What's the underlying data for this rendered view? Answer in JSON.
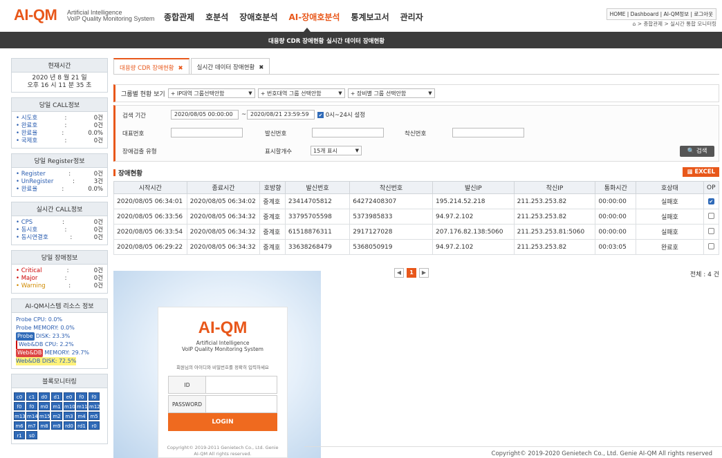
{
  "header": {
    "logo": "AI-QM",
    "logo_sub1": "Artificial Intelligence",
    "logo_sub2": "VoIP Quality Monitoring System",
    "menu": [
      "종합관제",
      "호분석",
      "장애호분석",
      "AI-장애호분석",
      "통계보고서",
      "관리자"
    ],
    "util": "HOME | Dashboard | AI-QM정보 | 로그아웃",
    "breadcrumb": "⌂ > 종합관제 > 실시간 통합 모니터링"
  },
  "subnav": [
    "대용량 CDR 장애현황",
    "실시간 데이터 장애현황"
  ],
  "sidebar": {
    "time_title": "현재시간",
    "time_line1": "2020 년 8 월 21 일",
    "time_line2": "오후 16 시 11 분 35 초",
    "call_title": "당일 CALL정보",
    "call_rows": [
      {
        "k": "• 시도호",
        "s": ":",
        "v": "0건"
      },
      {
        "k": "• 완료호",
        "s": ":",
        "v": "0건"
      },
      {
        "k": "• 완료율",
        "s": ":",
        "v": "0.0%"
      },
      {
        "k": "• 국제호",
        "s": ":",
        "v": "0건"
      }
    ],
    "reg_title": "당일 Register정보",
    "reg_rows": [
      {
        "k": "• Register",
        "s": ":",
        "v": "0건"
      },
      {
        "k": "• UnRegister",
        "s": ":",
        "v": "3건"
      },
      {
        "k": "• 완료율",
        "s": ":",
        "v": "0.0%"
      }
    ],
    "rt_title": "실시간 CALL정보",
    "rt_rows": [
      {
        "k": "• CPS",
        "s": ":",
        "v": "0건"
      },
      {
        "k": "• 동시호",
        "s": ":",
        "v": "0건"
      },
      {
        "k": "• 동시연결호",
        "s": ":",
        "v": "0건"
      }
    ],
    "alarm_title": "당일 장애정보",
    "alarm_rows": [
      {
        "k": "• Critical",
        "s": ":",
        "v": "0건"
      },
      {
        "k": "• Major",
        "s": ":",
        "v": "0건"
      },
      {
        "k": "• Warning",
        "s": ":",
        "v": "0건"
      }
    ],
    "res_title": "AI-QM시스템 리소스 정보",
    "res_lines": [
      "Probe CPU: 0.0%",
      "Probe MEMORY: 0.0%"
    ],
    "res_tagged": [
      {
        "tag": "Probe",
        "text": "DISK: 23.3%"
      },
      {
        "tag": "",
        "text": "Web&DB CPU: 2.2%"
      },
      {
        "tag": "Web&DB",
        "text": "MEMORY: 29.7%"
      },
      {
        "tag": "",
        "text": "Web&DB DISK: 72.5%"
      }
    ],
    "bm_title": "블록모니터링",
    "bm_items": [
      "c0",
      "c1",
      "d0",
      "d1",
      "e0",
      "f0",
      "f0",
      "f0",
      "f0",
      "m0",
      "m1",
      "m10",
      "m11",
      "m12",
      "m13",
      "m14",
      "m15",
      "m2",
      "m3",
      "m4",
      "m5",
      "m6",
      "m7",
      "m8",
      "m9",
      "rd0",
      "rd1",
      "r0",
      "r1",
      "s0"
    ]
  },
  "tabs": [
    "대용량 CDR 장애현황",
    "실시간 데이터 장애현황"
  ],
  "tab_close": "✖",
  "filter": {
    "group_label": "그룹별 현황 보기",
    "group_selects": [
      "+ IP대역 그룹선택안함",
      "+ 번호대역 그룹 선택안함",
      "+ 장비별 그룹 선택안함"
    ],
    "period_label": "검색 기간",
    "period_from": "2020/08/05 00:00:00",
    "period_sep": "~",
    "period_to": "2020/08/21 23:59:59",
    "period_check": "0시~24시 설정",
    "rep_label": "대표번호",
    "caller_label": "발신번호",
    "callee_label": "착신번호",
    "type_label": "장애검출 유형",
    "count_label": "표시할개수",
    "count_value": "15개 표시",
    "search_btn": "🔍 검색"
  },
  "section_title": "장애현황",
  "excel": "EXCEL",
  "table": {
    "headers": [
      "시작시간",
      "종료시간",
      "호방향",
      "발신번호",
      "착신번호",
      "발신IP",
      "착신IP",
      "통화시간",
      "호상태",
      "OP"
    ],
    "rows": [
      [
        "2020/08/05 06:34:01",
        "2020/08/05 06:34:02",
        "중계호",
        "23414705812",
        "64272408307",
        "195.214.52.218",
        "211.253.253.82",
        "00:00:00",
        "실패호"
      ],
      [
        "2020/08/05 06:33:56",
        "2020/08/05 06:34:32",
        "중계호",
        "33795705598",
        "5373985833",
        "94.97.2.102",
        "211.253.253.82",
        "00:00:00",
        "실패호"
      ],
      [
        "2020/08/05 06:33:54",
        "2020/08/05 06:34:32",
        "중계호",
        "61518876311",
        "2917127028",
        "207.176.82.138:5060",
        "211.253.253.81:5060",
        "00:00:00",
        "실패호"
      ],
      [
        "2020/08/05 06:29:22",
        "2020/08/05 06:34:32",
        "중계호",
        "33638268479",
        "5368050919",
        "94.97.2.102",
        "211.253.253.82",
        "00:03:05",
        "완료호"
      ]
    ],
    "checked": [
      true,
      false,
      false,
      false
    ]
  },
  "pager": {
    "prev": "◀",
    "current": "1",
    "next": "▶"
  },
  "total": "전체 : 4 건",
  "login": {
    "logo": "AI-QM",
    "sub1": "Artificial Intelligence",
    "sub2": "VoIP Quality Monitoring System",
    "hint": "회원님의 아이디와 비밀번호를 정확히 입력하세요",
    "id_label": "ID",
    "pw_label": "PASSWORD",
    "button": "LOGIN",
    "copy1": "Copyright© 2019-2011 Genietech Co., Ltd. Genie",
    "copy2": "AI-QM All rights reserved."
  },
  "footer": "Copyright© 2019-2020 Genietech Co., Ltd. Genie AI-QM All rights reserved",
  "colors": {
    "accent": "#e8571a",
    "dark": "#3b3b3b",
    "blue": "#2f6ab8"
  }
}
